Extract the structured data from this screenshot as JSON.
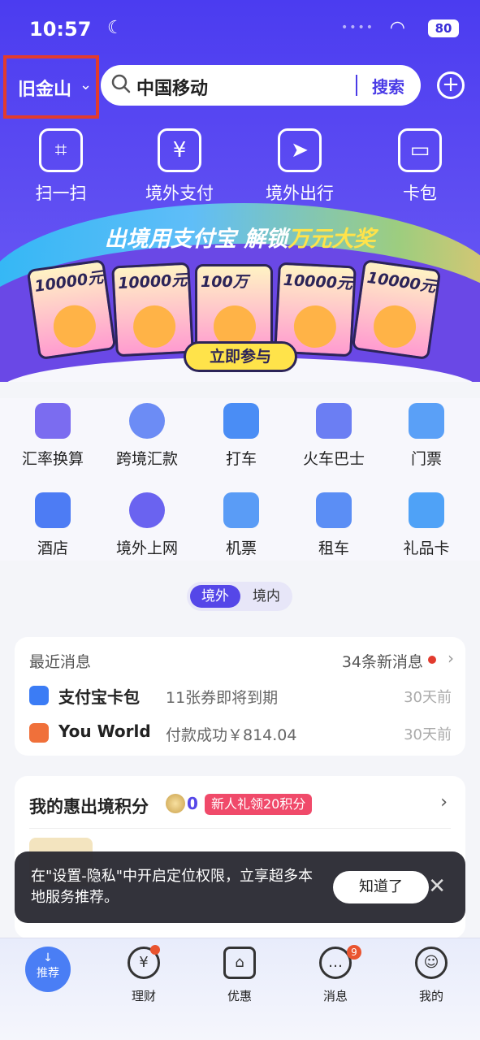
{
  "status": {
    "time": "10:57",
    "battery": "80"
  },
  "header": {
    "city": "旧金山",
    "search_text": "中国移动",
    "search_button": "搜索"
  },
  "quick_actions": [
    {
      "label": "扫一扫",
      "icon": "scan-icon"
    },
    {
      "label": "境外支付",
      "icon": "yen-pay-icon"
    },
    {
      "label": "境外出行",
      "icon": "travel-arrow-icon"
    },
    {
      "label": "卡包",
      "icon": "wallet-icon"
    }
  ],
  "banner": {
    "title_main": "出境用支付宝 解锁",
    "title_highlight": "万元大奖",
    "cards": [
      "10000元",
      "10000元",
      "100万",
      "10000元",
      "10000元"
    ],
    "cta": "立即参与"
  },
  "services": [
    {
      "label": "汇率换算",
      "color": "#7b6cf0"
    },
    {
      "label": "跨境汇款",
      "color": "#6c8cf5"
    },
    {
      "label": "打车",
      "color": "#4a8df5"
    },
    {
      "label": "火车巴士",
      "color": "#6b7ef3"
    },
    {
      "label": "门票",
      "color": "#5aa0f7"
    },
    {
      "label": "酒店",
      "color": "#4d7cf4"
    },
    {
      "label": "境外上网",
      "color": "#6a63f0"
    },
    {
      "label": "机票",
      "color": "#5a9cf6"
    },
    {
      "label": "租车",
      "color": "#5b8ef5"
    },
    {
      "label": "礼品卡",
      "color": "#4fa2f7"
    }
  ],
  "region_toggle": {
    "active": "境外",
    "inactive": "境内"
  },
  "messages": {
    "title": "最近消息",
    "count": "34条新消息",
    "items": [
      {
        "name": "支付宝卡包",
        "desc": "11张券即将到期",
        "time": "30天前",
        "icon_color": "#3b7cf5"
      },
      {
        "name": "You World",
        "desc": "付款成功￥814.04",
        "time": "30天前",
        "icon_color": "#f0703a"
      }
    ]
  },
  "points": {
    "title": "我的惠出境积分",
    "value": "0",
    "tag": "新人礼领20积分"
  },
  "toast": {
    "text": "在\"设置-隐私\"中开启定位权限，立享超多本地服务推荐。",
    "ok": "知道了"
  },
  "tabbar": [
    {
      "label": "推荐",
      "badge": ""
    },
    {
      "label": "理财",
      "badge": "dot"
    },
    {
      "label": "优惠",
      "badge": ""
    },
    {
      "label": "消息",
      "badge": "9"
    },
    {
      "label": "我的",
      "badge": ""
    }
  ]
}
